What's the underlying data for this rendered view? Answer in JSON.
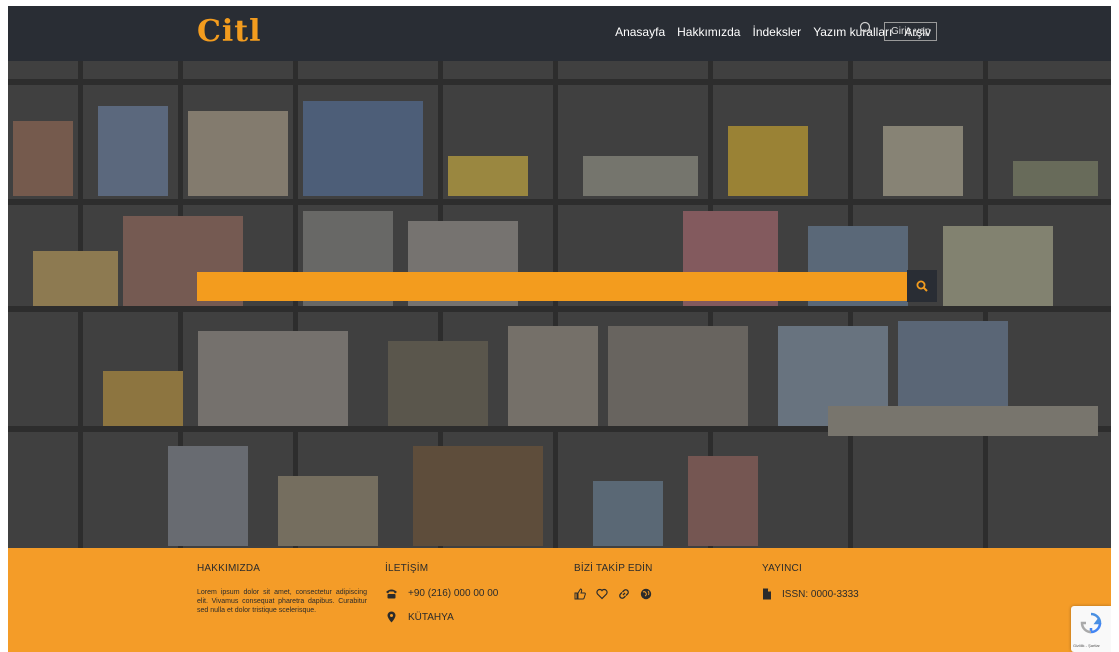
{
  "header": {
    "logo": "Citl",
    "nav": [
      "Anasayfa",
      "Hakkımızda",
      "İndeksler",
      "Yazım kuralları",
      "Arşiv"
    ],
    "login": "Giriş yap"
  },
  "search": {
    "placeholder": ""
  },
  "footer": {
    "about": {
      "title": "HAKKIMIZDA",
      "text": "Lorem ipsum dolor sit amet, consectetur adipiscing elit. Vivamus consequat pharetra dapibus. Curabitur sed nulla et dolor tristique scelerisque."
    },
    "contact": {
      "title": "İLETİŞİM",
      "phone": "+90 (216) 000 00 00",
      "location": "KÜTAHYA"
    },
    "follow": {
      "title": "BİZİ TAKİP EDİN",
      "icons": [
        "like-icon",
        "heart-icon",
        "link-icon",
        "globe-icon"
      ]
    },
    "publisher": {
      "title": "YAYINCI",
      "issn": "ISSN: 0000-3333"
    }
  },
  "recaptcha": {
    "text": "Gizlilik - Şartlar"
  },
  "colors": {
    "accent": "#f39c1e",
    "header": "#292d34"
  }
}
